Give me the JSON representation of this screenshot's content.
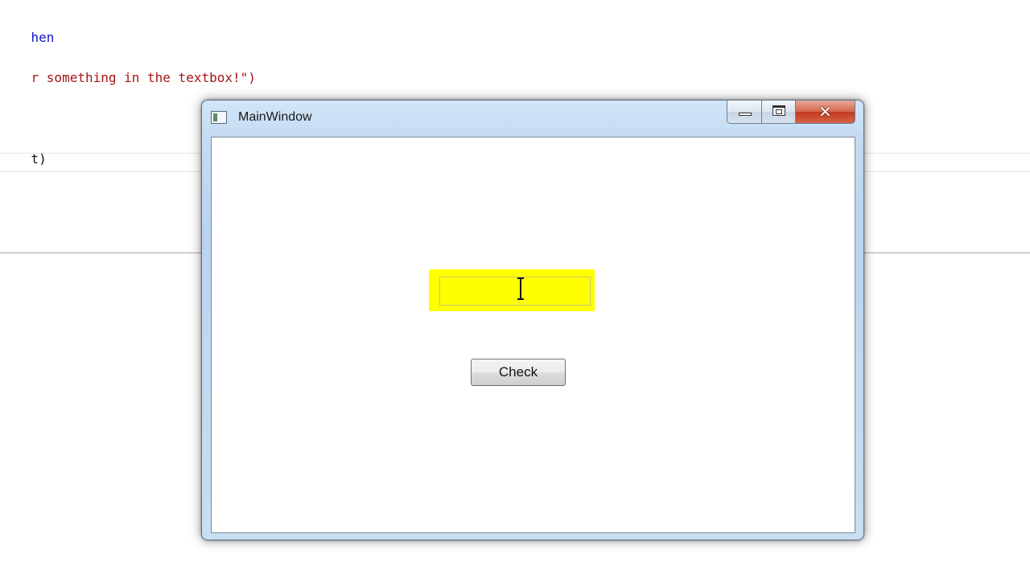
{
  "editor": {
    "lines": [
      {
        "parts": [
          {
            "text": "hen",
            "kind": "kw"
          }
        ]
      },
      {
        "parts": [
          {
            "text": "r something in the textbox!\")",
            "kind": "str"
          }
        ]
      },
      {
        "parts": [
          {
            "text": "t)",
            "kind": "plain"
          }
        ]
      }
    ]
  },
  "window": {
    "title": "MainWindow",
    "icons": {
      "app": "window-app-icon",
      "minimize": "minimize-icon",
      "maximize": "maximize-icon",
      "close": "close-icon"
    },
    "close_glyph": "✕"
  },
  "textbox": {
    "value": "",
    "highlight_color": "#ffff00"
  },
  "check_button": {
    "label": "Check"
  },
  "colors": {
    "keyword": "#1414c8",
    "string": "#a31515",
    "close_button": "#c0391f"
  }
}
